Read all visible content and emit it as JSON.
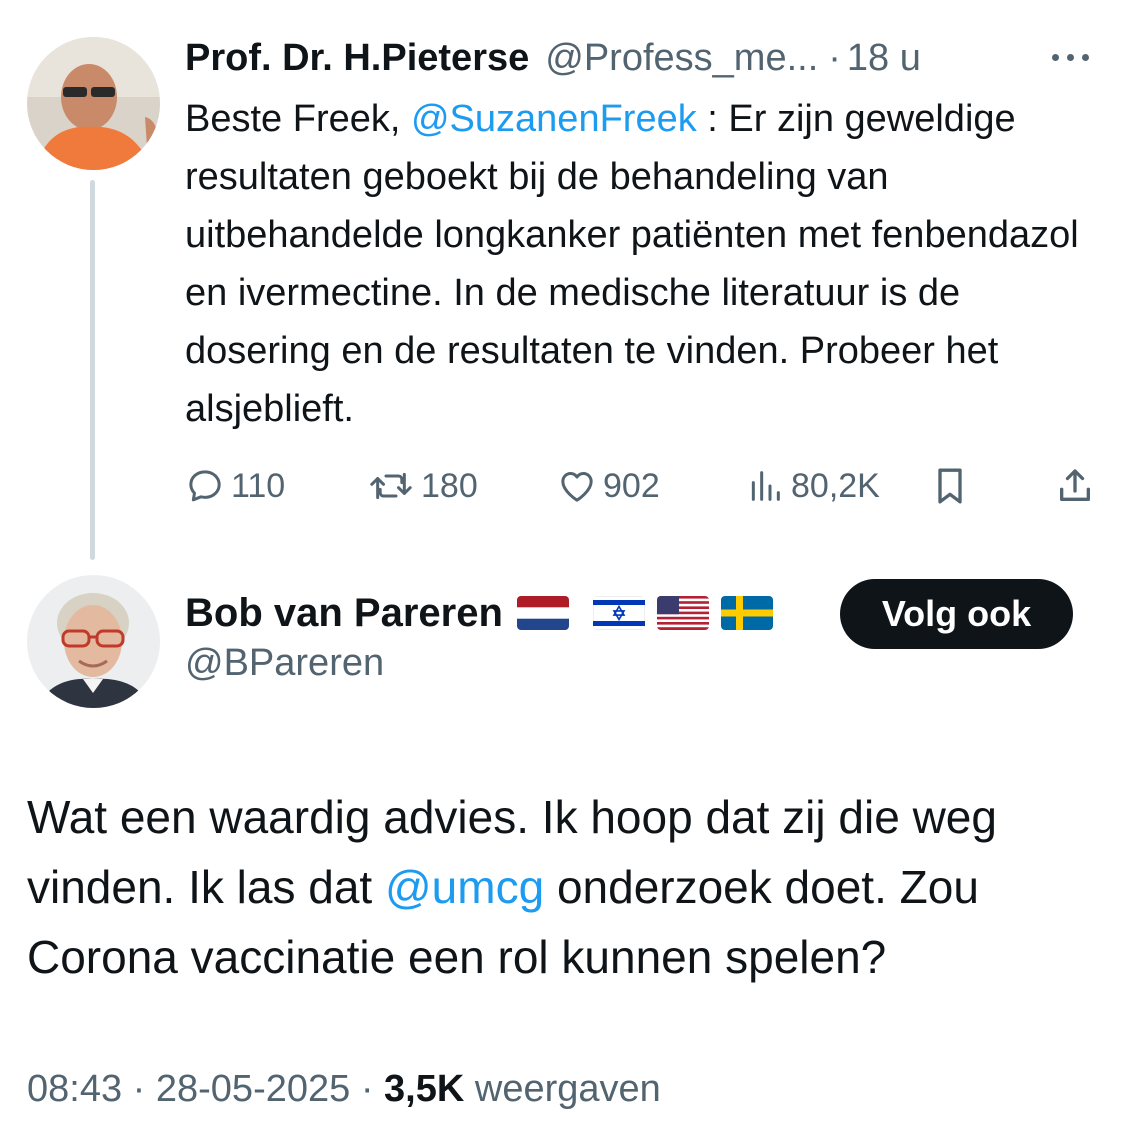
{
  "parent_tweet": {
    "author_name": "Prof. Dr. H.Pieterse",
    "handle": "@Profess_me...",
    "separator": "·",
    "time": "18 u",
    "text_prefix": "Beste Freek, ",
    "mention": "@SuzanenFreek",
    "text_rest": " : Er zijn geweldige resultaten geboekt bij de behandeling van uitbehandelde longkanker patiënten met fenbendazol en ivermectine. In de medische literatuur is de dosering en de resultaten te vinden. Probeer het alsjeblieft.",
    "replies": "110",
    "reposts": "180",
    "likes": "902",
    "views": "80,2K"
  },
  "reply_tweet": {
    "author_name": "Bob van Pareren",
    "flags": [
      "netherlands-flag",
      "israel-flag",
      "usa-flag",
      "sweden-flag"
    ],
    "handle": "@BPareren",
    "follow_label": "Volg ook",
    "text_prefix": "Wat een waardig advies. Ik hoop dat zij die weg vinden. Ik las dat ",
    "mention": "@umcg",
    "text_rest": " onderzoek doet. Zou Corona vaccinatie een rol kunnen spelen?",
    "time": "08:43",
    "separator": "·",
    "date": "28-05-2025",
    "views_count": "3,5K",
    "views_label": "weergaven"
  },
  "colors": {
    "text": "#0f1419",
    "secondary": "#536471",
    "link": "#1d9bf0",
    "thread_line": "#cfd9de",
    "button_bg": "#0f1419"
  }
}
